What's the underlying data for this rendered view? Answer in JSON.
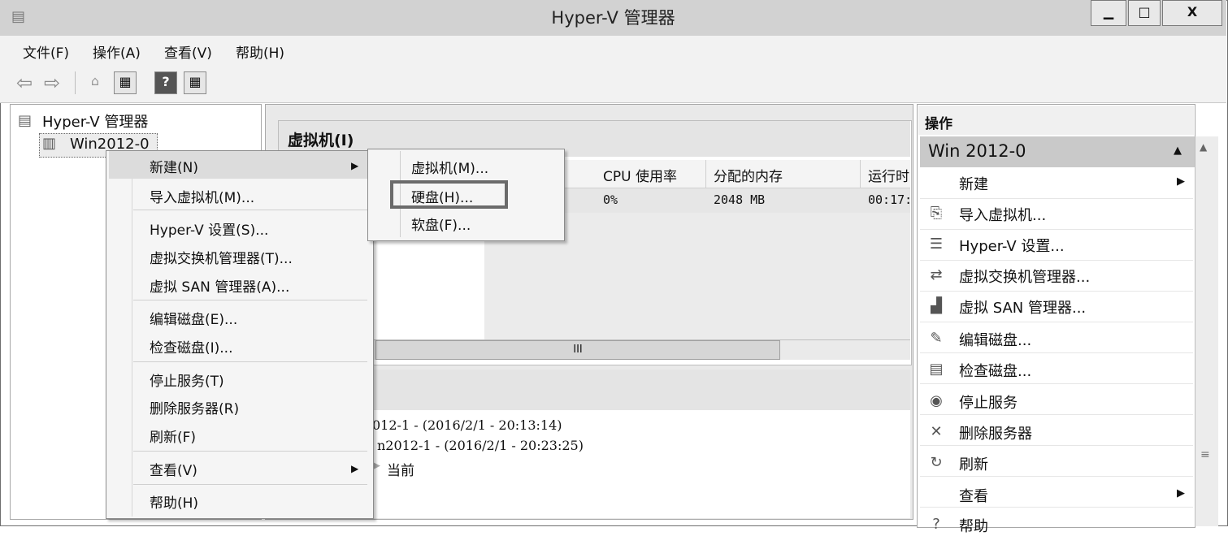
{
  "window": {
    "title": "Hyper-V 管理器",
    "minimize": "▁",
    "maximize": "□",
    "close": "X"
  },
  "menubar": [
    "文件(F)",
    "操作(A)",
    "查看(V)",
    "帮助(H)"
  ],
  "toolbar": {
    "back": "⇦",
    "forward": "⇨"
  },
  "tree": {
    "root": "Hyper-V 管理器",
    "server": "Win2012-0"
  },
  "vm_panel": {
    "title": "虚拟机(I)",
    "columns": [
      "CPU 使用率",
      "分配的内存",
      "运行时"
    ],
    "row": [
      "0%",
      "2048 MB",
      "00:17:"
    ],
    "scroll_label": "III"
  },
  "checkpoints": [
    "012-1 - (2016/2/1 - 20:13:14)",
    "n2012-1 - (2016/2/1 - 20:23:25)",
    "当前"
  ],
  "actions": {
    "title": "操作",
    "section": "Win 2012-0",
    "items": [
      "新建",
      "导入虚拟机...",
      "Hyper-V 设置...",
      "虚拟交换机管理器...",
      "虚拟 SAN 管理器...",
      "编辑磁盘...",
      "检查磁盘...",
      "停止服务",
      "删除服务器",
      "刷新",
      "查看",
      "帮助"
    ]
  },
  "context_menu": {
    "items": [
      "新建(N)",
      "导入虚拟机(M)...",
      "Hyper-V 设置(S)...",
      "虚拟交换机管理器(T)...",
      "虚拟 SAN 管理器(A)...",
      "编辑磁盘(E)...",
      "检查磁盘(I)...",
      "停止服务(T)",
      "删除服务器(R)",
      "刷新(F)",
      "查看(V)",
      "帮助(H)"
    ]
  },
  "submenu": {
    "items": [
      "虚拟机(M)...",
      "硬盘(H)...",
      "软盘(F)..."
    ]
  }
}
